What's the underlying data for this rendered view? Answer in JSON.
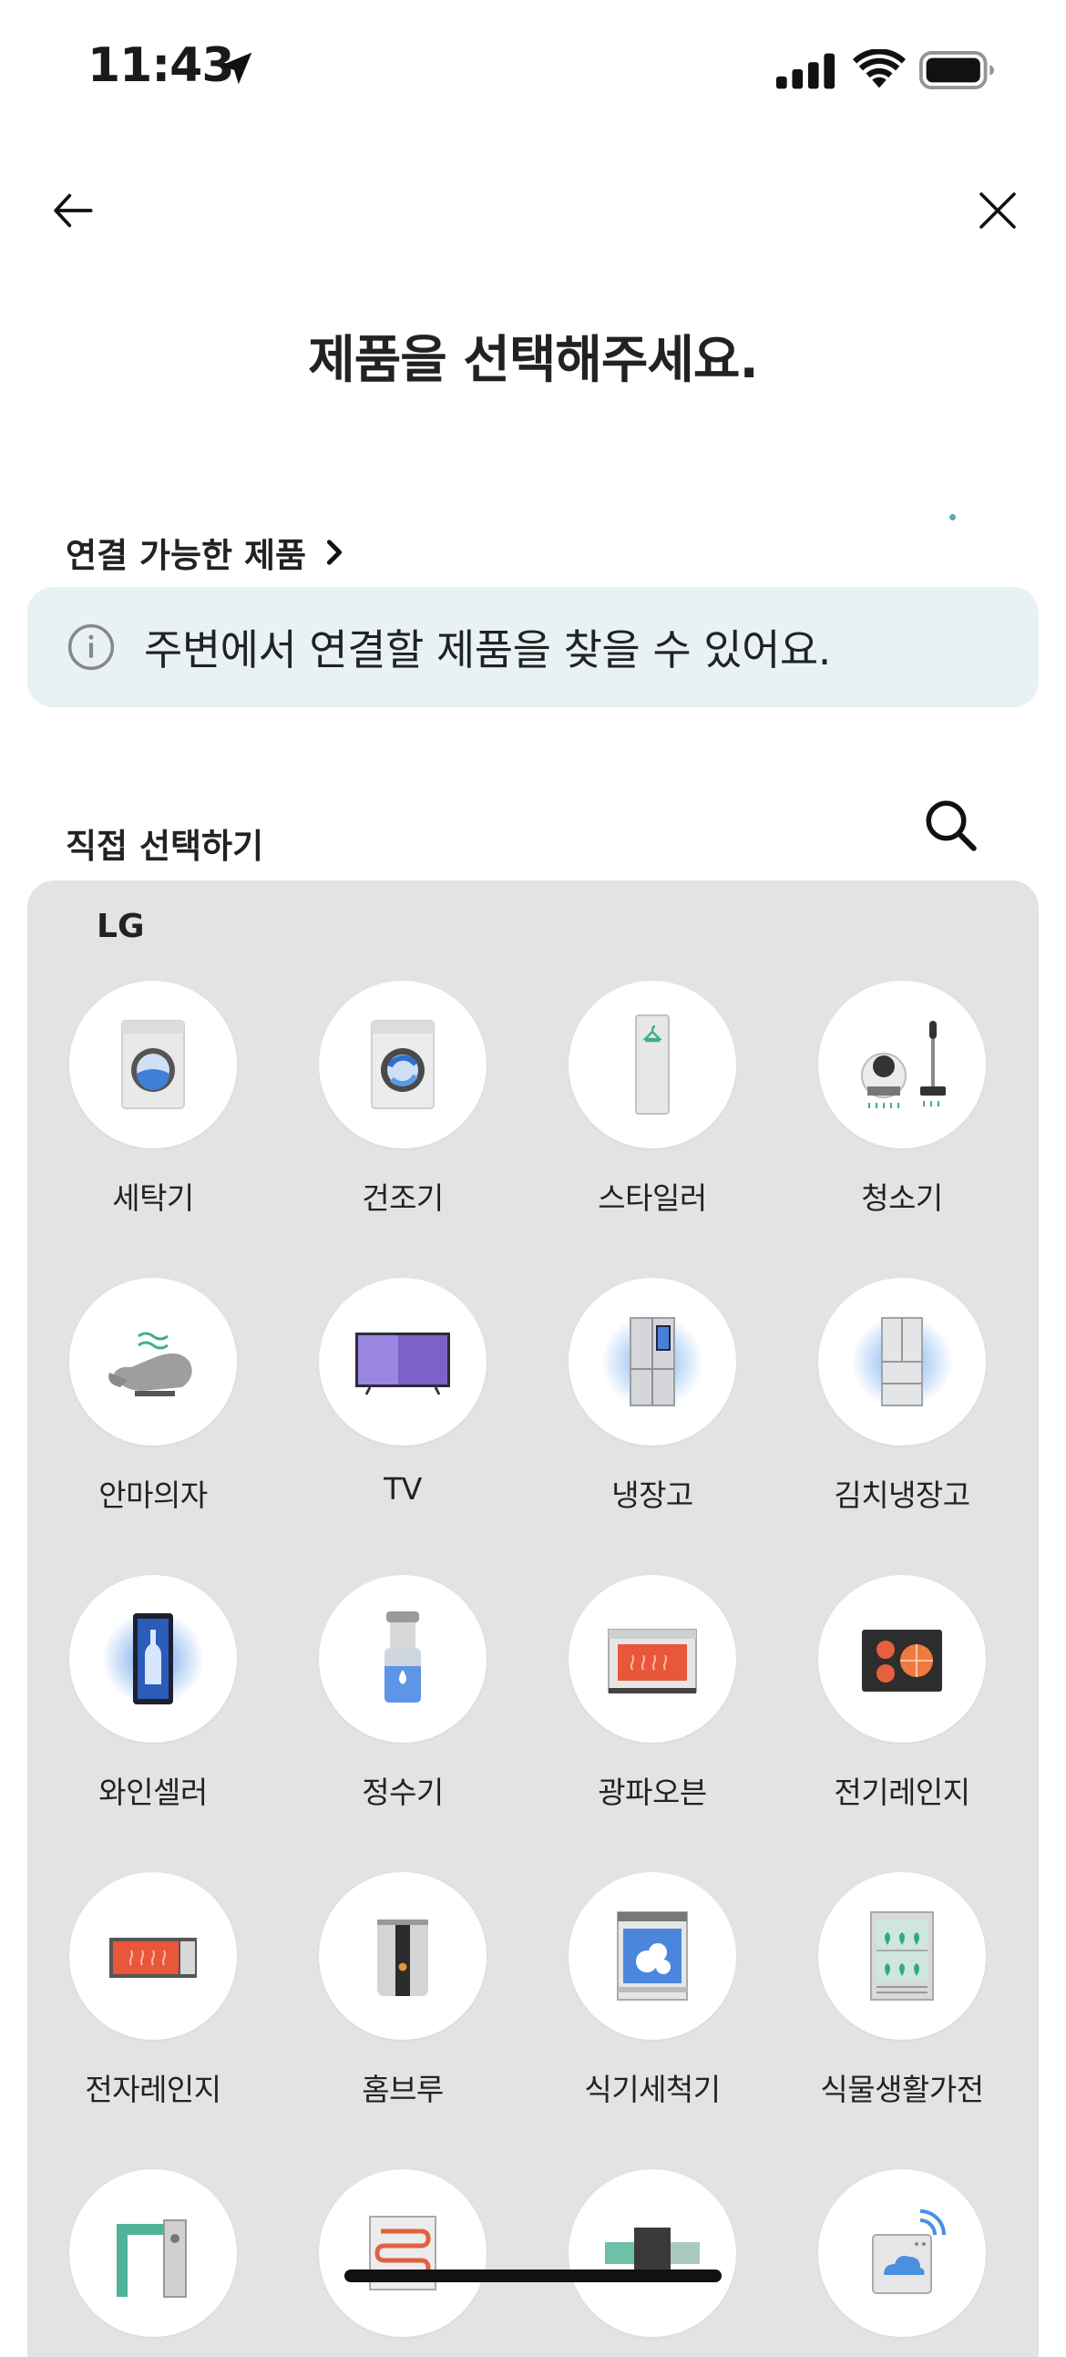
{
  "status_bar": {
    "time": "11:43"
  },
  "header": {
    "title": "제품을 선택해주세요."
  },
  "available": {
    "label": "연결 가능한 제품"
  },
  "info_banner": {
    "text": "주변에서 연결할 제품을 찾을 수 있어요."
  },
  "direct": {
    "label": "직접 선택하기"
  },
  "panel": {
    "brand": "LG",
    "products": [
      {
        "label": "세탁기",
        "icon": "washer-icon"
      },
      {
        "label": "건조기",
        "icon": "dryer-icon"
      },
      {
        "label": "스타일러",
        "icon": "styler-icon"
      },
      {
        "label": "청소기",
        "icon": "vacuum-icon"
      },
      {
        "label": "안마의자",
        "icon": "massage-chair-icon"
      },
      {
        "label": "TV",
        "icon": "tv-icon"
      },
      {
        "label": "냉장고",
        "icon": "refrigerator-icon"
      },
      {
        "label": "김치냉장고",
        "icon": "kimchi-refrigerator-icon"
      },
      {
        "label": "와인셀러",
        "icon": "wine-cellar-icon"
      },
      {
        "label": "정수기",
        "icon": "water-purifier-icon"
      },
      {
        "label": "광파오븐",
        "icon": "oven-icon"
      },
      {
        "label": "전기레인지",
        "icon": "electric-range-icon"
      },
      {
        "label": "전자레인지",
        "icon": "microwave-icon"
      },
      {
        "label": "홈브루",
        "icon": "homebrew-icon"
      },
      {
        "label": "식기세척기",
        "icon": "dishwasher-icon"
      },
      {
        "label": "식물생활가전",
        "icon": "plant-cultivator-icon"
      },
      {
        "label": "",
        "icon": "air-purifier-icon"
      },
      {
        "label": "",
        "icon": "heater-icon"
      },
      {
        "label": "",
        "icon": "ventilation-icon"
      },
      {
        "label": "",
        "icon": "smart-sensor-icon"
      }
    ]
  },
  "colors": {
    "banner_bg": "#e8f2f5",
    "panel_bg": "#e3e3e3",
    "accent_blue": "#4a8fe0"
  }
}
